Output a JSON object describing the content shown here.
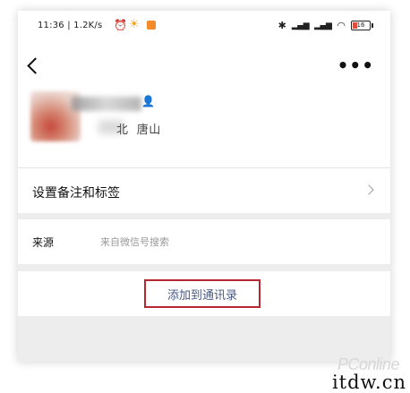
{
  "status_bar": {
    "time": "11:36",
    "speed": "1.2K/s",
    "battery": "16"
  },
  "navbar": {
    "back_icon": "chevron-left-icon",
    "more_icon": "more-dots-icon"
  },
  "profile": {
    "region_partial": "北",
    "city": "唐山"
  },
  "rows": {
    "remark_label": "设置备注和标签",
    "source_label": "来源",
    "source_value": "来自微信号搜索"
  },
  "actions": {
    "add_contact": "添加到通讯录"
  },
  "colors": {
    "highlight_border": "#b6272f",
    "link_text": "#4a5a85",
    "page_bg": "#ededed"
  },
  "watermark": {
    "brand": "PConline",
    "site": "itdw.cn"
  }
}
